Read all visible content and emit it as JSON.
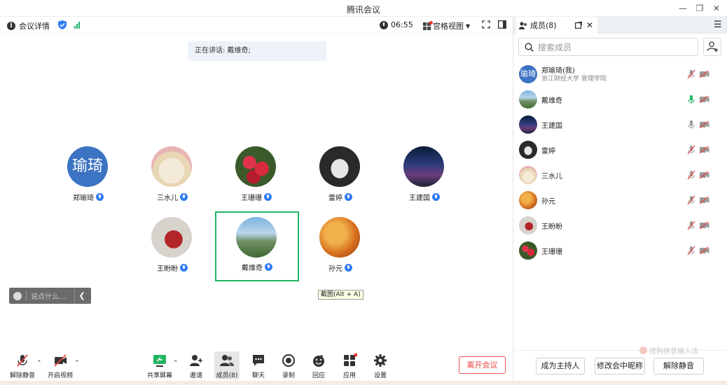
{
  "window": {
    "title": "腾讯会议"
  },
  "topbar": {
    "info_label": "会议详情",
    "time": "06:55",
    "view_label": "宫格视图"
  },
  "speaking": {
    "text": "正在讲话: 戴维奇;"
  },
  "grid": [
    {
      "name": "郑瑜琦",
      "avatar_text": "瑜琦"
    },
    {
      "name": "三水儿"
    },
    {
      "name": "王珊珊"
    },
    {
      "name": "雷婷"
    },
    {
      "name": "王建国"
    },
    {
      "name": "王盼盼"
    },
    {
      "name": "戴维奇"
    },
    {
      "name": "孙元"
    }
  ],
  "chat": {
    "placeholder": "说点什么..."
  },
  "tooltip": {
    "text": "截图(Alt + A)"
  },
  "toolbar": {
    "unmute": "解除静音",
    "video": "开启视频",
    "share": "共享屏幕",
    "invite": "邀请",
    "members": "成员(8)",
    "chat": "聊天",
    "record": "录制",
    "react": "回应",
    "apps": "应用",
    "settings": "设置",
    "leave": "离开会议"
  },
  "panel": {
    "tab_label": "成员(8)",
    "search_placeholder": "搜索成员",
    "members": [
      {
        "name": "郑瑜琦(我)",
        "sub": "浙江财经大学 管理学院",
        "avatar_text": "瑜琦",
        "mic": "muted"
      },
      {
        "name": "戴维奇",
        "mic": "active"
      },
      {
        "name": "王建国",
        "mic": "on"
      },
      {
        "name": "雷婷",
        "mic": "muted"
      },
      {
        "name": "三水儿",
        "mic": "muted"
      },
      {
        "name": "孙元",
        "mic": "muted"
      },
      {
        "name": "王盼盼",
        "mic": "muted"
      },
      {
        "name": "王珊珊",
        "mic": "muted"
      }
    ],
    "ime_text": "搜狗拼音输入法",
    "buttons": {
      "host": "成为主持人",
      "rename": "修改会中昵称",
      "unmute": "解除静音"
    }
  },
  "colors": {
    "accent": "#2f7cf6",
    "active_border": "#22b561",
    "leave": "#e84040",
    "avatar_blue": "#3c73c3"
  }
}
